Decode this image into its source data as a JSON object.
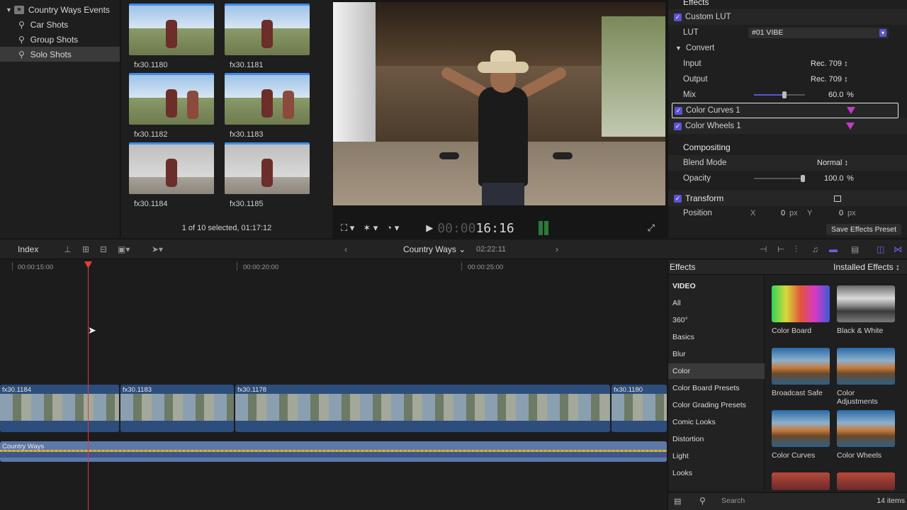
{
  "library": {
    "event": "Country Ways Events",
    "keywords": [
      "Car Shots",
      "Group Shots",
      "Solo Shots"
    ],
    "selected": "Solo Shots"
  },
  "browser": {
    "clips": [
      "fx30.1180",
      "fx30.1181",
      "fx30.1182",
      "fx30.1183",
      "fx30.1184",
      "fx30.1185"
    ],
    "status": "1 of 10 selected, 01:17:12"
  },
  "viewer": {
    "timecode_dim": "00:00",
    "timecode": "16:16"
  },
  "inspector": {
    "effects_header": "Effects",
    "custom_lut": "Custom LUT",
    "lut_label": "LUT",
    "lut_value": "#01 VIBE",
    "convert": "Convert",
    "input_label": "Input",
    "input_value": "Rec. 709 ↕",
    "output_label": "Output",
    "output_value": "Rec. 709 ↕",
    "mix_label": "Mix",
    "mix_value": "60.0",
    "mix_unit": "%",
    "mix_fraction": 0.6,
    "color_curves": "Color Curves 1",
    "color_wheels": "Color Wheels 1",
    "compositing": "Compositing",
    "blend_label": "Blend Mode",
    "blend_value": "Normal ↕",
    "opacity_label": "Opacity",
    "opacity_value": "100.0",
    "opacity_unit": "%",
    "transform": "Transform",
    "position_label": "Position",
    "pos_x_label": "X",
    "pos_x_value": "0",
    "pos_y_label": "Y",
    "pos_y_value": "0",
    "px_unit": "px",
    "save_preset": "Save Effects Preset",
    "accent": "#5b54d6"
  },
  "timeline_toolbar": {
    "index": "Index",
    "project": "Country Ways",
    "duration": "02:22:11"
  },
  "timeline": {
    "ruler": [
      "00:00:15:00",
      "00:00:20:00",
      "00:00:25:00"
    ],
    "clips": [
      "fx30.1184",
      "fx30.1183",
      "fx30.1178",
      "fx30.1180"
    ],
    "audio": "Country Ways"
  },
  "effects": {
    "title": "Effects",
    "installed": "Installed Effects ↕",
    "categories": [
      "VIDEO",
      "All",
      "360°",
      "Basics",
      "Blur",
      "Color",
      "Color Board Presets",
      "Color Grading Presets",
      "Comic Looks",
      "Distortion",
      "Light",
      "Looks"
    ],
    "selected_category": "Color",
    "items": [
      "Color Board",
      "Black & White",
      "Broadcast Safe",
      "Color Adjustments",
      "Color Curves",
      "Color Wheels"
    ],
    "search_placeholder": "Search",
    "count": "14 items"
  }
}
